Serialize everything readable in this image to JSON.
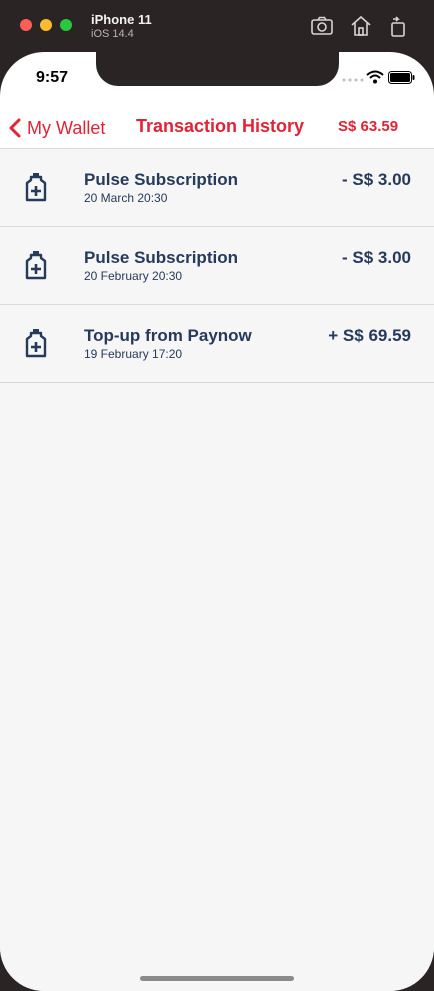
{
  "simulator": {
    "device_name": "iPhone 11",
    "os_version": "iOS 14.4"
  },
  "status_bar": {
    "time": "9:57"
  },
  "navbar": {
    "back_label": "My Wallet",
    "title": "Transaction History",
    "balance": "S$ 63.59"
  },
  "transactions": [
    {
      "title": "Pulse Subscription",
      "date": "20 March 20:30",
      "amount": "- S$ 3.00",
      "icon": "bottle-plus-icon"
    },
    {
      "title": "Pulse Subscription",
      "date": "20 February 20:30",
      "amount": "- S$ 3.00",
      "icon": "bottle-plus-icon"
    },
    {
      "title": "Top-up from Paynow",
      "date": "19 February 17:20",
      "amount": "+ S$ 69.59",
      "icon": "bottle-plus-icon"
    }
  ],
  "colors": {
    "accent": "#e02436",
    "text_primary": "#263a5b",
    "list_background": "#f6f6f6"
  }
}
